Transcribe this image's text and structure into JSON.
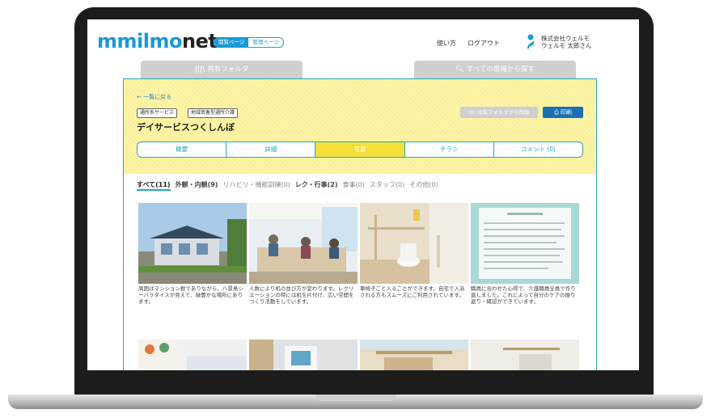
{
  "header": {
    "logo_icon": "m",
    "logo_text_1": "milmo",
    "logo_text_2": "net",
    "mode_view": "閲覧ページ",
    "mode_admin": "管理ページ",
    "how_to": "使い方",
    "logout": "ログアウト",
    "company": "株式会社ウェルモ",
    "user_name": "ウェルモ 太郎さん"
  },
  "top_tabs": {
    "shared": "共有フォルダ",
    "search": "すべての情報から探す"
  },
  "facility": {
    "back": "← 一覧に戻る",
    "tags": [
      "通所系サービス",
      "地域密着型通所介護"
    ],
    "name": "デイサービスつくしんぼ",
    "remove_button": "共有フォルダから削除",
    "print_button": "印刷"
  },
  "section_tabs": [
    "概要",
    "詳細",
    "写真",
    "チラシ",
    "コメント (0)"
  ],
  "filters": [
    "すべて(11)",
    "外観・内観(9)",
    "リハビリ・機能訓練(0)",
    "レク・行事(2)",
    "食事(0)",
    "スタッフ(0)",
    "その他(0)"
  ],
  "photos": [
    {
      "caption": "周囲はマンション群でありながら、八景島シーパラダイスが見えて、緑豊かな場所にあります。"
    },
    {
      "caption": "人数により机の並び方が変わります。レクリエーションの時には机を片付け、広い空間をつくり活動をしています。"
    },
    {
      "caption": "車椅子ごと入ることができます。自宅で入浴される方もスムーズにご利用されています。"
    },
    {
      "caption": "職員に合わせた心得で、介護職員全員で作り直しました。これによって自分のケアの振り返り・確認ができています。"
    }
  ],
  "colors": {
    "brand": "#1a9ad6",
    "accent": "#26a7b8",
    "panel": "#fbf19a",
    "active_tab": "#f5e03a",
    "print_button": "#1a6fb4"
  }
}
